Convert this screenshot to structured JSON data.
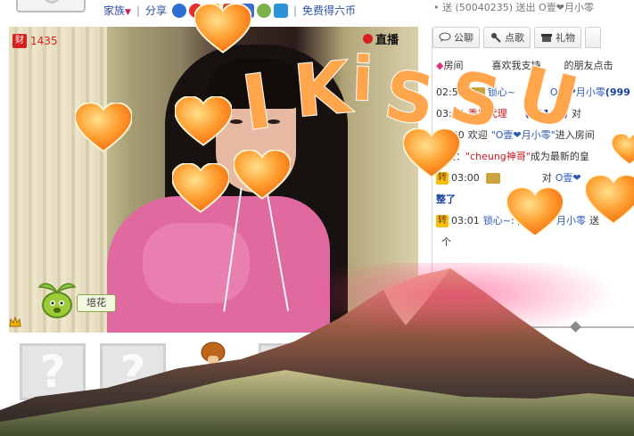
{
  "topbar": {
    "family_label": "家族",
    "share_label": "分享",
    "separator": "|",
    "coins_link": "免费得六币",
    "right_text": "• 送 (50040235) 送出 O壹❤月小零"
  },
  "video": {
    "wealth_badge": "财",
    "wealth_value": "1435",
    "live_label": "直播",
    "plant_label": "培花"
  },
  "tabs": [
    {
      "label": "公聊",
      "icon": "chat-bubble-icon"
    },
    {
      "label": "点歌",
      "icon": "microphone-icon"
    },
    {
      "label": "礼物",
      "icon": "gift-icon"
    }
  ],
  "chat": {
    "row0_prefix": "房间",
    "row0_text": "喜欢我支持",
    "row0_suffix": "的朋友点击",
    "row1_time": "02:56",
    "row1_nick": "锁心~",
    "row1_to": "对",
    "row1_target": "O壹❤月小零",
    "row1_value": "(999",
    "row2_time": "03:00",
    "row2_nick": "秀房代理",
    "row2_id": "(61106)",
    "row2_to": "对",
    "row3_time": "03:00",
    "row3_welcome": "欢迎",
    "row3_nick": "\"O壹❤月小零\"",
    "row3_suffix": "进入房间",
    "row4_label": "快报：",
    "row4_nick": "\"cheung神哥\"",
    "row4_suffix": "成为最新的皇",
    "row5_tag": "转",
    "row5_time": "03:00",
    "row5_to": "对",
    "row5_target": "O壹❤",
    "row6_text": "整了",
    "row7_tag": "转",
    "row7_time": "03:01",
    "row7_nick": "锁心~",
    "row7_to": ": 向",
    "row7_target": "O壹❤月小零",
    "row7_send": "送",
    "row8_text": "个"
  },
  "bottom": {
    "question_mark": "?"
  },
  "overlay": {
    "letters": [
      "I",
      "K",
      "i",
      "S",
      "S",
      "U"
    ]
  },
  "colors": {
    "accent_red": "#d42020",
    "link_blue": "#2a4f9f",
    "heart_orange": "#ff9c2e"
  }
}
